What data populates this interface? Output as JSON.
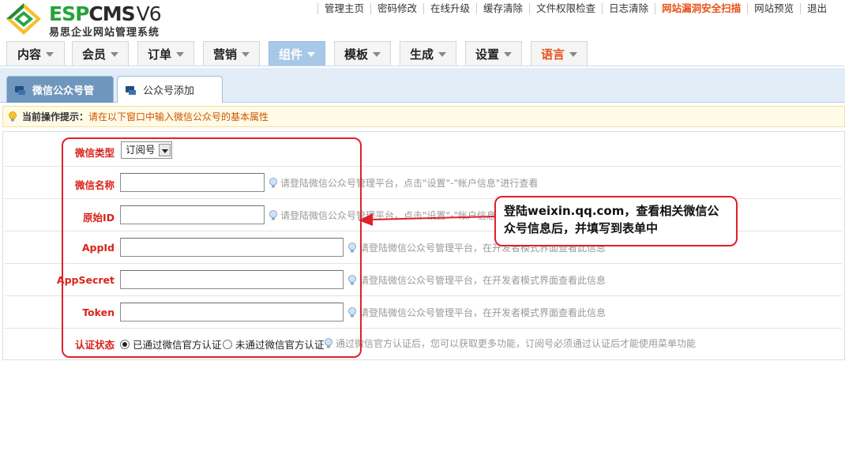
{
  "logo": {
    "brand_a": "ESP",
    "brand_b": "CMS",
    "version": "V6",
    "subtitle": "易思企业网站管理系统"
  },
  "toplinks": [
    "管理主页",
    "密码修改",
    "在线升级",
    "缓存清除",
    "文件权限检查",
    "日志清除",
    "网站漏洞安全扫描",
    "网站预览",
    "退出"
  ],
  "mainnav": [
    "内容",
    "会员",
    "订单",
    "营销",
    "组件",
    "模板",
    "生成",
    "设置",
    "语言"
  ],
  "subtabs": [
    "微信公众号管",
    "公众号添加"
  ],
  "hint": {
    "label": "当前操作提示：",
    "text": "请在以下窗口中输入微信公众号的基本属性"
  },
  "form": {
    "type_label": "微信类型",
    "type_value": "订阅号",
    "name_label": "微信名称",
    "name_tip": "请登陆微信公众号管理平台，点击\"设置\"-\"帐户信息\"进行查看",
    "origin_label": "原始ID",
    "origin_tip": "请登陆微信公众号管理平台，点击\"设置\"-\"帐户信息\"进行查看",
    "appid_label": "AppId",
    "appid_tip": "请登陆微信公众号管理平台，在开发者模式界面查看此信息",
    "secret_label": "AppSecret",
    "secret_tip": "请登陆微信公众号管理平台，在开发者模式界面查看此信息",
    "token_label": "Token",
    "token_tip": "请登陆微信公众号管理平台，在开发者模式界面查看此信息",
    "auth_label": "认证状态",
    "auth_opt1": "已通过微信官方认证",
    "auth_opt2": "未通过微信官方认证",
    "auth_tip": "通过微信官方认证后，您可以获取更多功能，订阅号必须通过认证后才能使用菜单功能"
  },
  "callout": {
    "line1": "登陆weixin.qq.com，查看相关微信公",
    "line2": "众号信息后，并填写到表单中"
  },
  "colors": {
    "accent_red": "#e0202a",
    "nav_active": "#a8c8e8",
    "link_highlight": "#e4541a"
  }
}
